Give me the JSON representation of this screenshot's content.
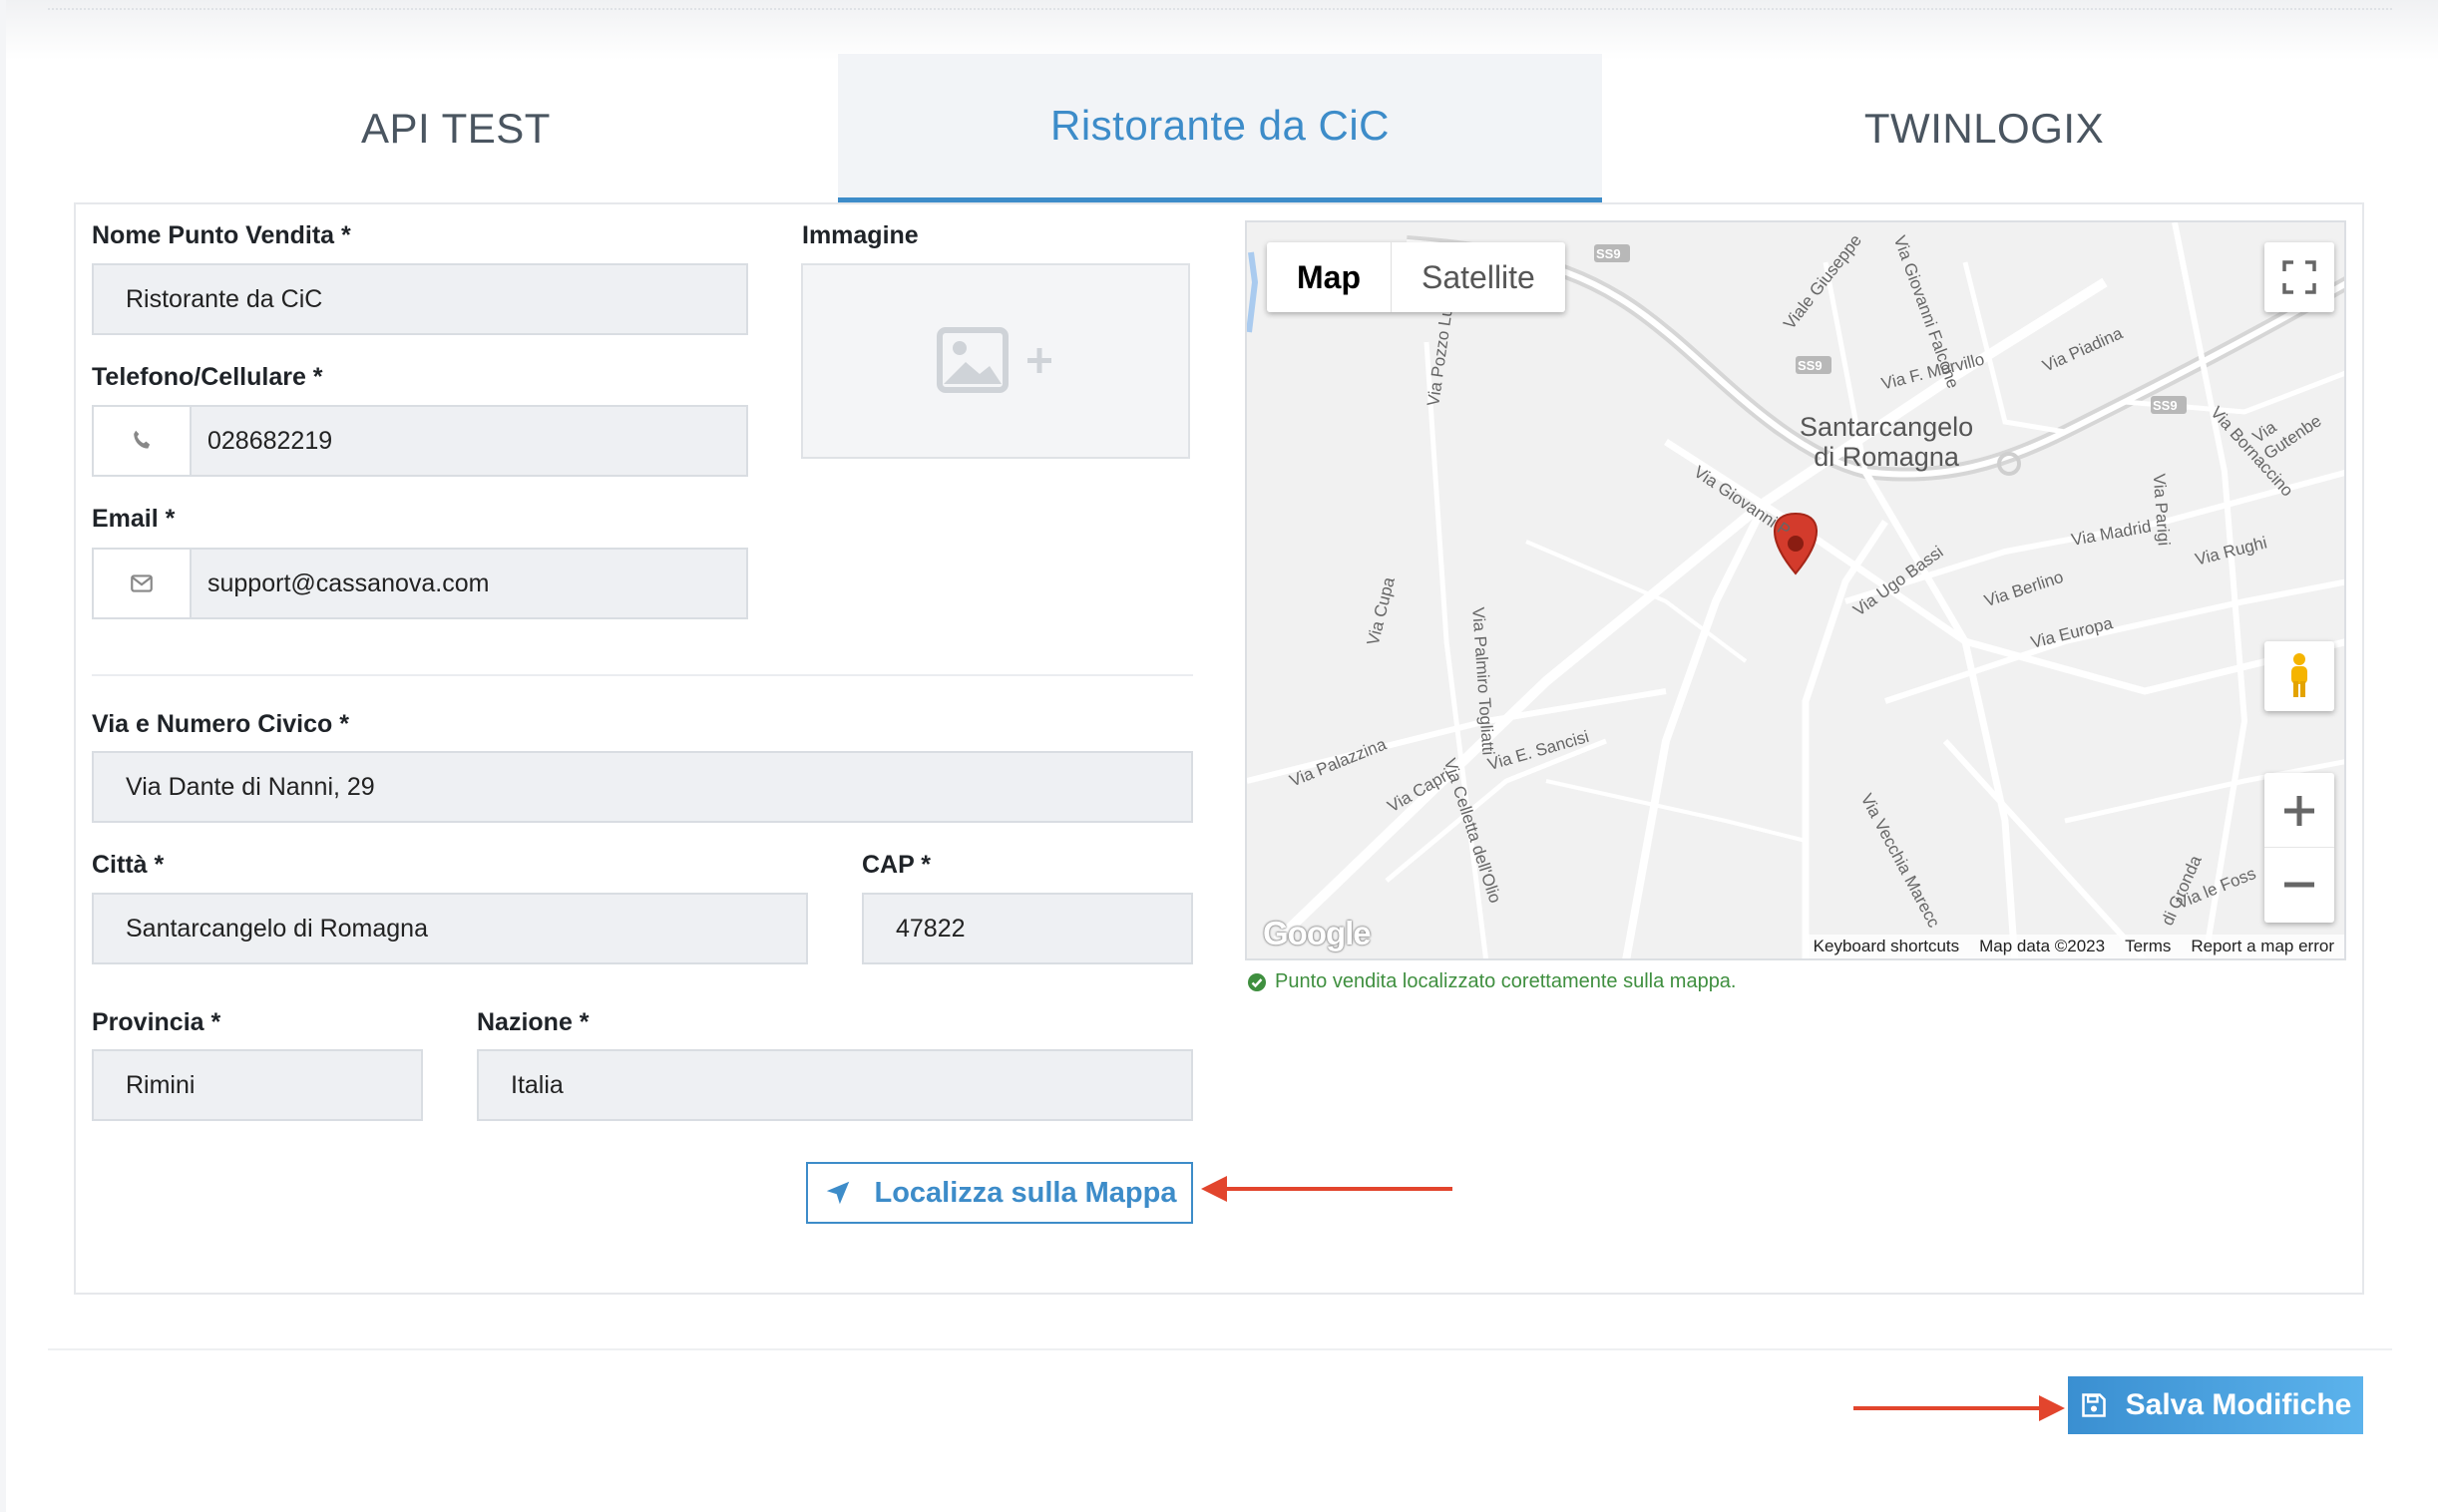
{
  "tabs": [
    {
      "label": "API TEST"
    },
    {
      "label": "Ristorante da CiC"
    },
    {
      "label": "TWINLOGIX"
    }
  ],
  "form": {
    "name_label": "Nome Punto Vendita *",
    "name_value": "Ristorante da CiC",
    "image_label": "Immagine",
    "phone_label": "Telefono/Cellulare *",
    "phone_value": "028682219",
    "phone_icon": "phone-icon",
    "email_label": "Email *",
    "email_value": "support@cassanova.com",
    "email_icon": "envelope-icon",
    "street_label": "Via e Numero Civico *",
    "street_value": "Via Dante di Nanni, 29",
    "city_label": "Città *",
    "city_value": "Santarcangelo di Romagna",
    "cap_label": "CAP *",
    "cap_value": "47822",
    "province_label": "Provincia *",
    "province_value": "Rimini",
    "country_label": "Nazione *",
    "country_value": "Italia",
    "locate_button": "Localizza sulla Mappa"
  },
  "map": {
    "type_map": "Map",
    "type_satellite": "Satellite",
    "town_line1": "Santarcangelo",
    "town_line2": "di Romagna",
    "streets": [
      "Via Giovanni P",
      "Via Ugo Bassi",
      "Via Berlino",
      "Via Europa",
      "Via Madrid",
      "Via Rughi",
      "Via Parigi",
      "Via Piadina",
      "Via F. Morvillo",
      "Via Cupa",
      "Via Palmiro Togliatti",
      "Via Palazzina",
      "Via Capri",
      "Via E. Sancisi",
      "Via Celletta dell'Olio",
      "Via Vecchia Marecc",
      "Via Pozzo Lun",
      "Viale Giuseppe",
      "Via Giovanni Falcone",
      "Via Bornaccino",
      "Via Gutenbe",
      "di Gronda",
      "Via le Foss"
    ],
    "road_badge": "SS9",
    "footer": {
      "shortcuts": "Keyboard shortcuts",
      "data": "Map data ©2023",
      "terms": "Terms",
      "report": "Report a map error"
    },
    "logo": "Google",
    "status": "Punto vendita localizzato corettamente sulla mappa."
  },
  "actions": {
    "save_button": "Salva Modifiche"
  },
  "colors": {
    "accent": "#3d8cc9",
    "arrow": "#e2452d",
    "success": "#3f8f3f"
  }
}
